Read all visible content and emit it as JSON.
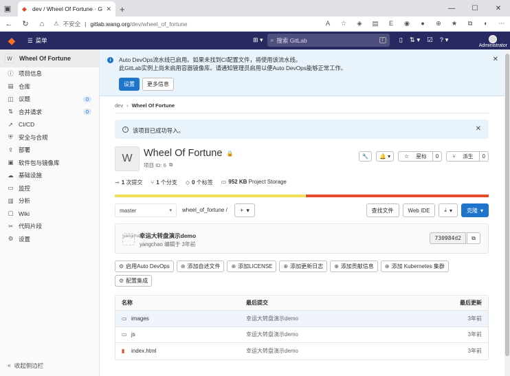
{
  "browser": {
    "tab_title": "dev / Wheel Of Fortune · GitLab",
    "close": "✕",
    "new_tab": "+",
    "insecure_label": "不安全",
    "url_host": "gitlab.wang.org",
    "url_path": "/dev/wheel_of_fortune",
    "window_controls": [
      "—",
      "☐",
      "✕"
    ]
  },
  "topbar": {
    "menu_label": "菜单",
    "search_placeholder": "搜索 GitLab",
    "search_key": "/",
    "user_label": "Administrator"
  },
  "sidebar": {
    "project_avatar": "W",
    "project_name": "Wheel Of Fortune",
    "items": [
      {
        "label": "项目信息",
        "icon": "info-icon",
        "badge": ""
      },
      {
        "label": "仓库",
        "icon": "doc-icon",
        "badge": ""
      },
      {
        "label": "议题",
        "icon": "issues-icon",
        "badge": "0"
      },
      {
        "label": "合并请求",
        "icon": "merge-icon",
        "badge": "0"
      },
      {
        "label": "CI/CD",
        "icon": "rocket-icon",
        "badge": ""
      },
      {
        "label": "安全与合规",
        "icon": "shield-icon",
        "badge": ""
      },
      {
        "label": "部署",
        "icon": "deploy-icon",
        "badge": ""
      },
      {
        "label": "软件包与镜像库",
        "icon": "package-icon",
        "badge": ""
      },
      {
        "label": "基础设施",
        "icon": "cloud-icon",
        "badge": ""
      },
      {
        "label": "监控",
        "icon": "monitor-icon",
        "badge": ""
      },
      {
        "label": "分析",
        "icon": "chart-icon",
        "badge": ""
      },
      {
        "label": "Wiki",
        "icon": "book-icon",
        "badge": ""
      },
      {
        "label": "代码片段",
        "icon": "snippet-icon",
        "badge": ""
      },
      {
        "label": "设置",
        "icon": "gear-icon",
        "badge": ""
      }
    ],
    "collapse_label": "收起侧边栏"
  },
  "alert": {
    "line1": "Auto DevOps流水线已启用。如果未找到CI配置文件，将使用该流水线。",
    "line2": "此GitLab实例上尚未启用容器镜像库。请通知管理员启用以便Auto DevOps能够正常工作。",
    "primary_btn": "设置",
    "secondary_btn": "更多信息"
  },
  "breadcrumb": {
    "group": "dev",
    "project": "Wheel Of Fortune"
  },
  "import_notice": "该项目已成功导入。",
  "project": {
    "avatar": "W",
    "title": "Wheel Of Fortune",
    "id_label": "项目 ID: 6",
    "star_label": "星标",
    "star_count": "0",
    "fork_label": "派生",
    "fork_count": "0"
  },
  "stats": {
    "commits_num": "1",
    "commits_label": "次提交",
    "branches_num": "1",
    "branches_label": "个分支",
    "tags_num": "0",
    "tags_label": "个标签",
    "storage_num": "952 KB",
    "storage_label": "Project Storage"
  },
  "languages": [
    {
      "share": 51,
      "color": "#f1e05a"
    },
    {
      "share": 49,
      "color": "#e34c26"
    }
  ],
  "toolbar": {
    "branch": "master",
    "path": "wheel_of_fortune",
    "find_file": "查找文件",
    "web_ide": "Web IDE",
    "clone": "克隆"
  },
  "commit": {
    "avatar_alt": "yangchao",
    "title": "幸运大转盘演示demo",
    "author": "yangchao",
    "when": "编辑于 3年前",
    "sha": "730984d2"
  },
  "quick_actions": [
    {
      "label": "启用Auto DevOps",
      "icon": "gear-icon"
    },
    {
      "label": "添加自述文件",
      "icon": "plus-icon"
    },
    {
      "label": "添加LICENSE",
      "icon": "plus-icon"
    },
    {
      "label": "添加更新日志",
      "icon": "plus-icon"
    },
    {
      "label": "添加贡献信息",
      "icon": "plus-icon"
    },
    {
      "label": "添加 Kubernetes 集群",
      "icon": "plus-icon"
    },
    {
      "label": "配置集成",
      "icon": "gear-icon"
    }
  ],
  "files": {
    "headers": [
      "名称",
      "最后提交",
      "最后更新"
    ],
    "rows": [
      {
        "name": "images",
        "type": "folder",
        "commit": "幸运大转盘演示demo",
        "updated": "3年前"
      },
      {
        "name": "js",
        "type": "folder",
        "commit": "幸运大转盘演示demo",
        "updated": "3年前"
      },
      {
        "name": "index.html",
        "type": "html",
        "commit": "幸运大转盘演示demo",
        "updated": "3年前"
      }
    ]
  }
}
